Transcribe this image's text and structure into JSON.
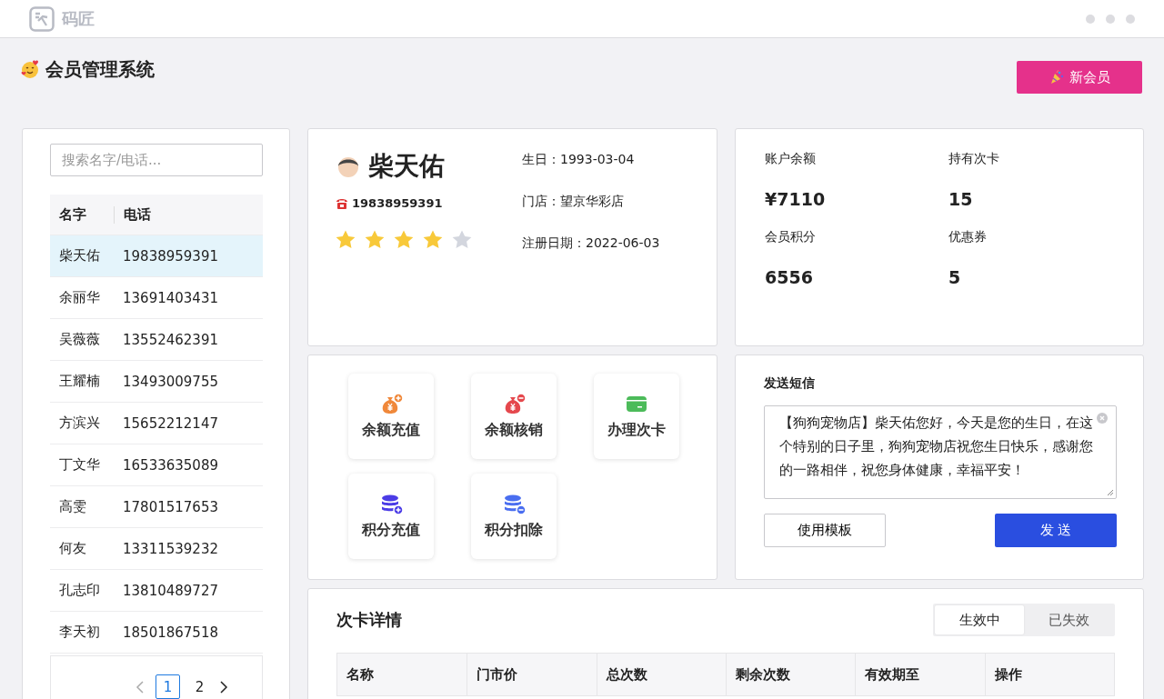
{
  "app_bar": {
    "brand": "码匠"
  },
  "header": {
    "title": "会员管理系统",
    "new_button": "新会员"
  },
  "member_list": {
    "search": {
      "placeholder": "搜索名字/电话..."
    },
    "columns": [
      "名字",
      "电话"
    ],
    "rows": [
      {
        "name": "柴天佑",
        "phone": "19838959391",
        "selected": true
      },
      {
        "name": "余丽华",
        "phone": "13691403431",
        "selected": false
      },
      {
        "name": "吴薇薇",
        "phone": "13552462391",
        "selected": false
      },
      {
        "name": "王耀楠",
        "phone": "13493009755",
        "selected": false
      },
      {
        "name": "方滨兴",
        "phone": "15652212147",
        "selected": false
      },
      {
        "name": "丁文华",
        "phone": "16533635089",
        "selected": false
      },
      {
        "name": "高雯",
        "phone": "17801517653",
        "selected": false
      },
      {
        "name": "何友",
        "phone": "13311539232",
        "selected": false
      },
      {
        "name": "孔志印",
        "phone": "13810489727",
        "selected": false
      },
      {
        "name": "李天初",
        "phone": "18501867518",
        "selected": false
      }
    ],
    "pagination": {
      "pages": [
        {
          "label": "1",
          "selected": true
        },
        {
          "label": "2",
          "selected": false
        }
      ]
    }
  },
  "profile": {
    "name": "柴天佑",
    "phone": "19838959391",
    "stars": 4,
    "details": [
      "生日：1993-03-04",
      "门店：望京华彩店",
      "注册日期：2022-06-03"
    ]
  },
  "account": {
    "stats": [
      {
        "label": "账户余额",
        "value": "¥7110"
      },
      {
        "label": "持有次卡",
        "value": "15"
      },
      {
        "label": "会员积分",
        "value": "6556"
      },
      {
        "label": "优惠券",
        "value": "5"
      }
    ]
  },
  "actions": [
    {
      "label": "余额充值",
      "kind": "bag-plus"
    },
    {
      "label": "余额核销",
      "kind": "bag-minus"
    },
    {
      "label": "办理次卡",
      "kind": "card"
    },
    {
      "label": "积分充值",
      "kind": "coins-plus"
    },
    {
      "label": "积分扣除",
      "kind": "coins-minus"
    }
  ],
  "sms": {
    "title": "发送短信",
    "message": "【狗狗宠物店】柴天佑您好，今天是您的生日，在这个特别的日子里，狗狗宠物店祝您生日快乐，感谢您的一路相伴，祝您身体健康，幸福平安！",
    "template_button": "使用模板",
    "send_button": "发 送"
  },
  "cards": {
    "title": "次卡详情",
    "tabs": [
      {
        "label": "生效中",
        "selected": true
      },
      {
        "label": "已失效",
        "selected": false
      }
    ],
    "columns": [
      "名称",
      "门市价",
      "总次数",
      "剩余次数",
      "有效期至",
      "操作"
    ]
  }
}
